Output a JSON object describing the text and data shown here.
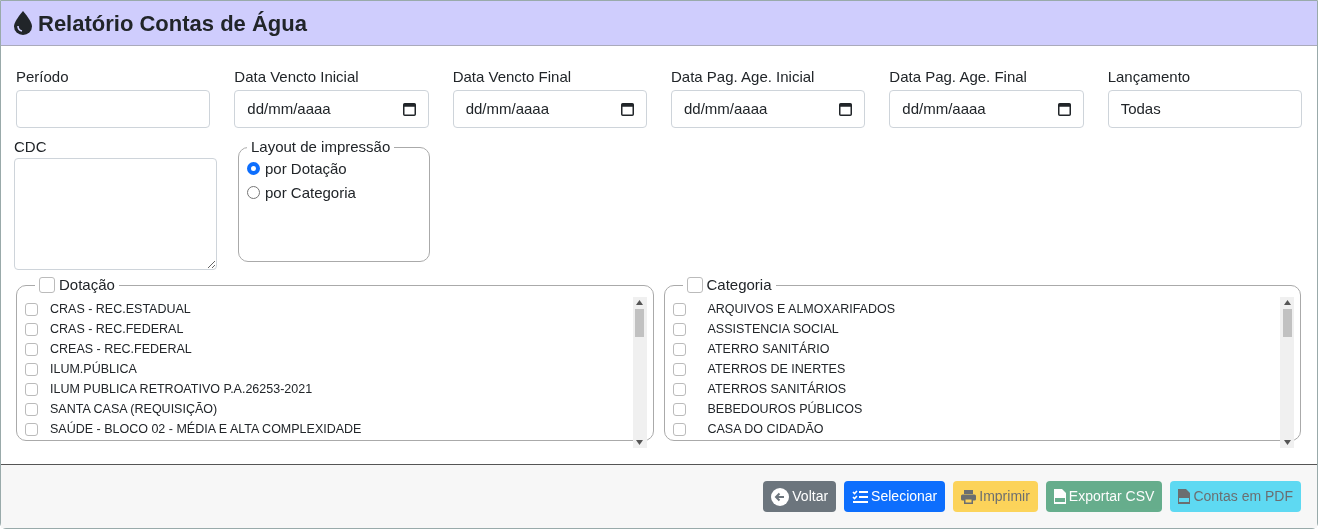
{
  "header": {
    "title": "Relatório Contas de Água"
  },
  "fields": [
    {
      "label": "Período",
      "kind": "text"
    },
    {
      "label": "Data Vencto Inicial",
      "kind": "date",
      "placeholder": "dd/mm/aaaa"
    },
    {
      "label": "Data Vencto Final",
      "kind": "date",
      "placeholder": "dd/mm/aaaa"
    },
    {
      "label": "Data Pag. Age. Inicial",
      "kind": "date",
      "placeholder": "dd/mm/aaaa"
    },
    {
      "label": "Data Pag. Age. Final",
      "kind": "date",
      "placeholder": "dd/mm/aaaa"
    },
    {
      "label": "Lançamento",
      "kind": "text",
      "value": "Todas"
    }
  ],
  "cdc": {
    "label": "CDC"
  },
  "layout": {
    "legend": "Layout de impressão",
    "options": [
      {
        "label": "por Dotação",
        "selected": true
      },
      {
        "label": "por Categoria",
        "selected": false
      }
    ]
  },
  "lists": [
    {
      "legend": "Dotação",
      "checked": false,
      "items": [
        {
          "label": "CRAS - REC.ESTADUAL",
          "checked": false
        },
        {
          "label": "CRAS - REC.FEDERAL",
          "checked": false
        },
        {
          "label": "CREAS - REC.FEDERAL",
          "checked": false
        },
        {
          "label": "ILUM.PÚBLICA",
          "checked": false
        },
        {
          "label": "ILUM PUBLICA RETROATIVO P.A.26253-2021",
          "checked": false
        },
        {
          "label": "SANTA CASA (REQUISIÇÃO)",
          "checked": false
        },
        {
          "label": "SAÚDE - BLOCO 02 - MÉDIA E ALTA COMPLEXIDADE",
          "checked": false
        }
      ]
    },
    {
      "legend": "Categoria",
      "checked": false,
      "items": [
        {
          "label": "ARQUIVOS E ALMOXARIFADOS",
          "checked": false
        },
        {
          "label": "ASSISTENCIA SOCIAL",
          "checked": false
        },
        {
          "label": "ATERRO SANITÁRIO",
          "checked": false
        },
        {
          "label": "ATERROS DE INERTES",
          "checked": false
        },
        {
          "label": "ATERROS SANITÁRIOS",
          "checked": false
        },
        {
          "label": "BEBEDOUROS PÚBLICOS",
          "checked": false
        },
        {
          "label": "CASA DO CIDADÃO",
          "checked": false
        }
      ]
    }
  ],
  "buttons": [
    {
      "label": "Voltar",
      "kind": "back"
    },
    {
      "label": "Selecionar",
      "kind": "select"
    },
    {
      "label": "Imprimir",
      "kind": "print",
      "disabled": true
    },
    {
      "label": "Exportar CSV",
      "kind": "csv",
      "disabled": true
    },
    {
      "label": "Contas em PDF",
      "kind": "pdf",
      "disabled": true
    }
  ]
}
